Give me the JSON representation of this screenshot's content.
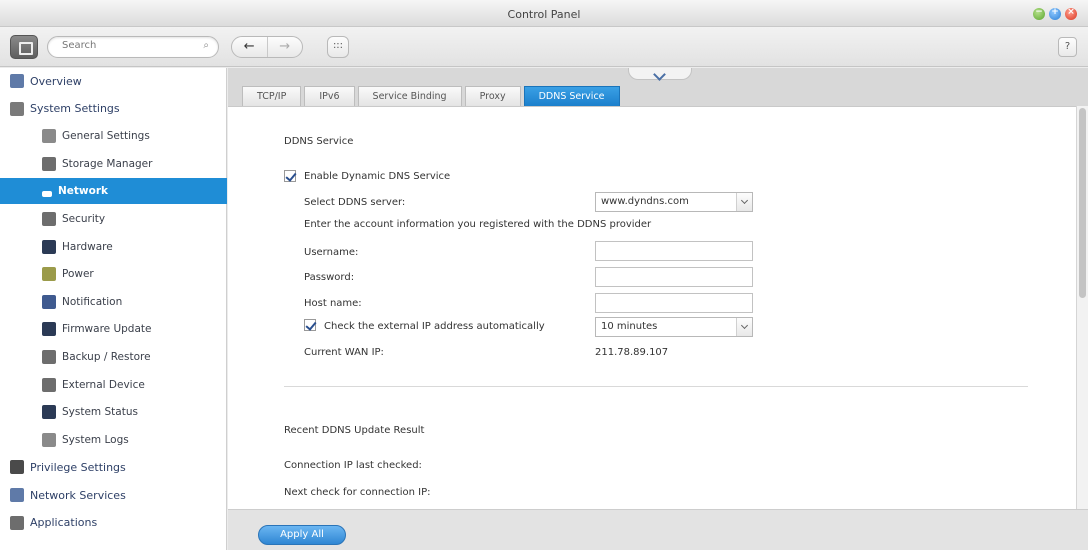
{
  "window": {
    "title": "Control Panel",
    "min_glyph": "−",
    "max_glyph": "+",
    "close_glyph": "×"
  },
  "toolbar": {
    "search_placeholder": "Search",
    "search_icon": "magnifier-icon",
    "back_glyph": "←",
    "forward_glyph": "→",
    "apps_glyph": ":::",
    "help_label": "?"
  },
  "sidebar": {
    "top": [
      {
        "label": "Overview",
        "icon": "overview-icon",
        "color": "#5f7aa8"
      },
      {
        "label": "System Settings",
        "icon": "gear-icon",
        "color": "#7a7a7a"
      }
    ],
    "sub": [
      {
        "label": "General Settings",
        "icon": "settings-sheet-icon",
        "color": "#8a8a8a"
      },
      {
        "label": "Storage Manager",
        "icon": "storage-icon",
        "color": "#6d6d6d"
      },
      {
        "label": "Network",
        "icon": "network-icon",
        "color": "#ffffff"
      },
      {
        "label": "Security",
        "icon": "lock-icon",
        "color": "#6d6d6d"
      },
      {
        "label": "Hardware",
        "icon": "hardware-icon",
        "color": "#2b3a55"
      },
      {
        "label": "Power",
        "icon": "bulb-icon",
        "color": "#9b9b4a"
      },
      {
        "label": "Notification",
        "icon": "notification-icon",
        "color": "#3f5a8f"
      },
      {
        "label": "Firmware Update",
        "icon": "firmware-icon",
        "color": "#2b3a55"
      },
      {
        "label": "Backup / Restore",
        "icon": "backup-icon",
        "color": "#6d6d6d"
      },
      {
        "label": "External Device",
        "icon": "external-device-icon",
        "color": "#6d6d6d"
      },
      {
        "label": "System Status",
        "icon": "monitor-icon",
        "color": "#2b3a55"
      },
      {
        "label": "System Logs",
        "icon": "logs-icon",
        "color": "#8a8a8a"
      }
    ],
    "bottom": [
      {
        "label": "Privilege Settings",
        "icon": "user-icon",
        "color": "#4a4a4a"
      },
      {
        "label": "Network Services",
        "icon": "network-services-icon",
        "color": "#5f7aa8"
      },
      {
        "label": "Applications",
        "icon": "applications-icon",
        "color": "#6d6d6d"
      }
    ],
    "active": "Network",
    "active_color": "#1f8dd6"
  },
  "tabs": [
    {
      "label": "TCP/IP",
      "active": false
    },
    {
      "label": "IPv6",
      "active": false
    },
    {
      "label": "Service Binding",
      "active": false
    },
    {
      "label": "Proxy",
      "active": false
    },
    {
      "label": "DDNS Service",
      "active": true
    }
  ],
  "ddns": {
    "section_title": "DDNS Service",
    "enable_label": "Enable Dynamic DNS Service",
    "enable_checked": true,
    "server_label": "Select DDNS server:",
    "server_value": "www.dyndns.com",
    "account_note": "Enter the account information you registered with the DDNS provider",
    "username_label": "Username:",
    "username_value": "",
    "password_label": "Password:",
    "password_value": "",
    "hostname_label": "Host name:",
    "hostname_value": "",
    "check_ip_label": "Check the external IP address automatically",
    "check_ip_checked": true,
    "check_interval_value": "10 minutes",
    "wan_ip_label": "Current WAN IP:",
    "wan_ip_value": "211.78.89.107"
  },
  "recent": {
    "section_title": "Recent DDNS Update Result",
    "last_checked_label": "Connection IP last checked:",
    "next_check_label": "Next check for connection IP:"
  },
  "footer": {
    "apply_label": "Apply All"
  }
}
